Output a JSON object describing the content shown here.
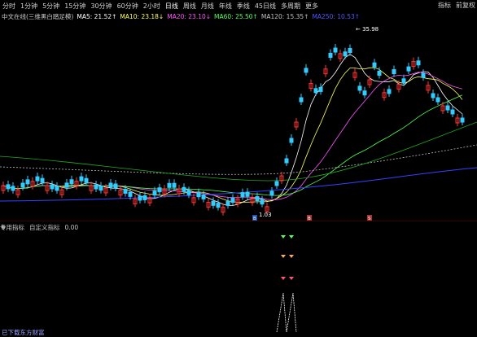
{
  "toolbar": {
    "items": [
      "分时",
      "1分钟",
      "5分钟",
      "15分钟",
      "30分钟",
      "60分钟",
      "2小时",
      "日线",
      "周线",
      "月线",
      "年线",
      "季线",
      "45日线",
      "多周期",
      "更多"
    ],
    "active_index": 7,
    "right": [
      "指标",
      "前复权"
    ]
  },
  "ma_legend": {
    "title": "中文在线(三维黑白踏足模)",
    "items": [
      {
        "label": "MA5: 21.52↑",
        "color": "#ffffff"
      },
      {
        "label": "MA10: 23.18↓",
        "color": "#ffff55"
      },
      {
        "label": "MA20: 23.10↓",
        "color": "#ff55ff"
      },
      {
        "label": "MA60: 25.50↑",
        "color": "#55ff55"
      },
      {
        "label": "MA120: 15.35↑",
        "color": "#c0c0c0"
      },
      {
        "label": "MA250: 10.53↑",
        "color": "#5555ff"
      }
    ]
  },
  "chart_annotations": {
    "high_label": "35.98",
    "low_label": "1.03"
  },
  "indicator_legend": {
    "items": [
      "专用指标",
      "自定义指标",
      "0.00"
    ]
  },
  "status_text": "已下载东方财富",
  "colors": {
    "up": "#ff3333",
    "down": "#33ccff",
    "background": "#000000"
  },
  "markers": {
    "bottom_labels": [
      "B",
      "B",
      "S"
    ]
  },
  "chart_data": {
    "type": "candlestick",
    "title": "中文在线",
    "price_labels": {
      "max": "35.98",
      "min": "1.03"
    },
    "ma_series": [
      "MA5",
      "MA10",
      "MA20",
      "MA60",
      "MA120",
      "MA250"
    ]
  }
}
